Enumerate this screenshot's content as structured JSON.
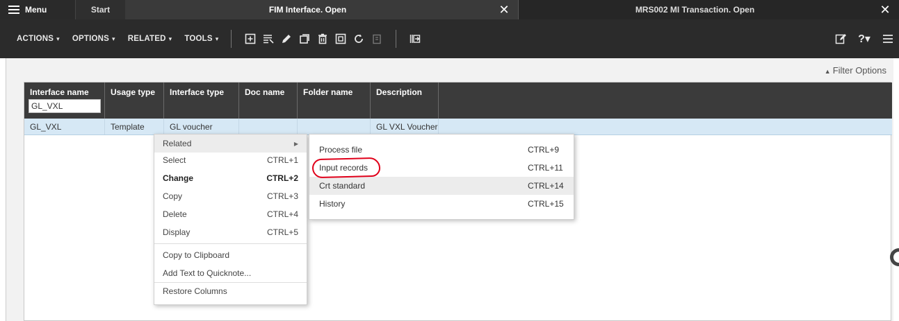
{
  "tabbar": {
    "menu_label": "Menu",
    "start_label": "Start",
    "tab1_title": "FIM Interface. Open",
    "tab1_close": "✕",
    "tab2_title": "MRS002 MI Transaction. Open",
    "tab2_close": "✕"
  },
  "toolbar": {
    "actions": "ACTIONS",
    "options": "OPTIONS",
    "related": "RELATED",
    "tools": "TOOLS",
    "caret": "▾",
    "help": "?▾"
  },
  "filter_options": "Filter Options",
  "grid": {
    "headers": [
      "Interface name",
      "Usage type",
      "Interface type",
      "Doc name",
      "Folder name",
      "Description"
    ],
    "filter_value": "GL_VXL",
    "row": [
      "GL_VXL",
      "Template",
      "GL voucher",
      "",
      "",
      "GL VXL Voucher"
    ]
  },
  "context_menu": {
    "related": "Related",
    "select": "Select",
    "select_sc": "CTRL+1",
    "change": "Change",
    "change_sc": "CTRL+2",
    "copy": "Copy",
    "copy_sc": "CTRL+3",
    "delete": "Delete",
    "delete_sc": "CTRL+4",
    "display": "Display",
    "display_sc": "CTRL+5",
    "copy_clipboard": "Copy to Clipboard",
    "add_quicknote": "Add Text to Quicknote...",
    "restore_columns": "Restore Columns"
  },
  "submenu": {
    "process_file": "Process file",
    "process_file_sc": "CTRL+9",
    "input_records": "Input records",
    "input_records_sc": "CTRL+11",
    "crt_standard": "Crt standard",
    "crt_standard_sc": "CTRL+14",
    "history": "History",
    "history_sc": "CTRL+15"
  },
  "colors": {
    "annotation_red": "#e0001a",
    "header_bg": "#3b3b3b",
    "selected_row": "#d6e8f5"
  }
}
